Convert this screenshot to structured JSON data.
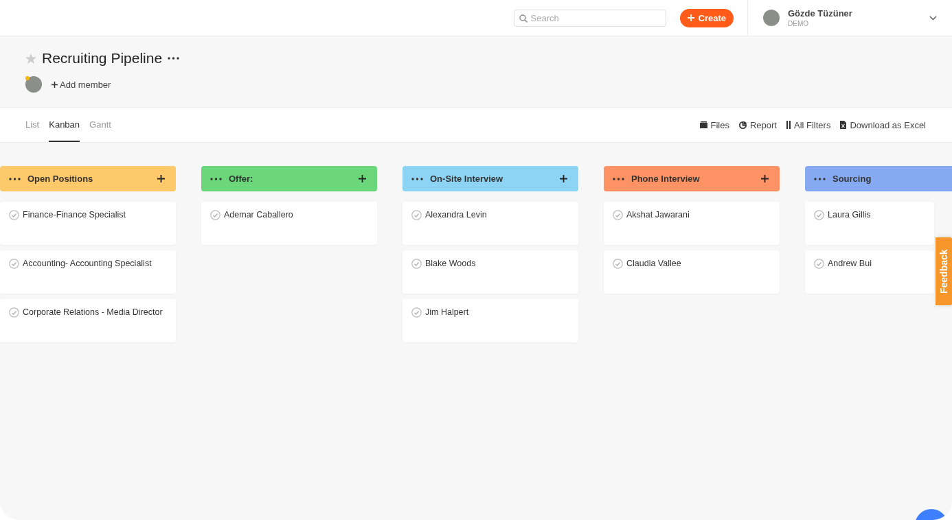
{
  "topbar": {
    "search": {
      "placeholder": "Search"
    },
    "create_button": "Create",
    "user": {
      "name": "Gözde Tüzüner",
      "subtitle": "DEMO"
    }
  },
  "project": {
    "title": "Recruiting Pipeline",
    "add_member": "Add member"
  },
  "tabs": [
    {
      "label": "List",
      "selected": false
    },
    {
      "label": "Kanban",
      "selected": true
    },
    {
      "label": "Gantt",
      "selected": false
    }
  ],
  "actions": [
    {
      "kind": "files",
      "label": "Files"
    },
    {
      "kind": "report",
      "label": "Report"
    },
    {
      "kind": "filters",
      "label": "All Filters"
    },
    {
      "kind": "excel",
      "label": "Download as Excel"
    }
  ],
  "columns": [
    {
      "title": "Open Positions",
      "color": "#fdc96b",
      "cards": [
        "Finance-Finance Specialist",
        "Accounting- Accounting Specialist",
        "Corporate Relations - Media Director"
      ]
    },
    {
      "title": "Offer:",
      "color": "#6cd67b",
      "cards": [
        "Ademar Caballero"
      ]
    },
    {
      "title": "On-Site Interview",
      "color": "#8dd4f4",
      "cards": [
        "Alexandra Levin",
        "Blake Woods",
        "Jim Halpert"
      ]
    },
    {
      "title": "Phone Interview",
      "color": "#fd9264",
      "cards": [
        "Akshat Jawarani",
        "Claudia Vallee"
      ]
    },
    {
      "title": "Sourcing",
      "color": "#86aaf1",
      "cards": [
        "Laura Gillis",
        "Andrew Bui"
      ]
    }
  ],
  "feedback": "Feedback"
}
